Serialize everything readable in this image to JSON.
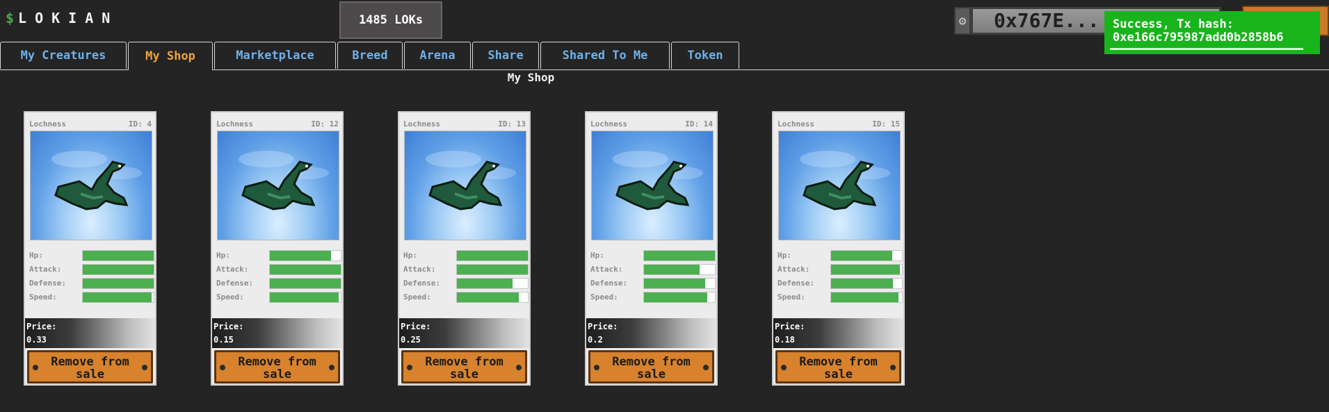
{
  "app": {
    "logo_text": "LOKIAN",
    "logo_symbol": "$"
  },
  "header": {
    "balance": "1485 LOKs",
    "wallet_address": "0x767E...",
    "toast": "Success, Tx hash:\n0xe166c795987add0b2858b6"
  },
  "tabs": [
    {
      "label": "My Creatures",
      "active": false
    },
    {
      "label": "My Shop",
      "active": true
    },
    {
      "label": "Marketplace",
      "active": false
    },
    {
      "label": "Breed",
      "active": false
    },
    {
      "label": "Arena",
      "active": false
    },
    {
      "label": "Share",
      "active": false
    },
    {
      "label": "Shared To Me",
      "active": false
    },
    {
      "label": "Token",
      "active": false
    }
  ],
  "section_title": "My Shop",
  "stat_labels": {
    "hp": "Hp:",
    "attack": "Attack:",
    "defense": "Defense:",
    "speed": "Speed:"
  },
  "price_label": "Price:",
  "remove_label": "Remove from sale",
  "colors": {
    "accent_tab": "#f2a33a",
    "tab_text": "#6fb1ea",
    "stat_fill": "#4caf50",
    "toast_bg": "#19b41c",
    "button": "#d8822e"
  },
  "cards": [
    {
      "name": "Lochness",
      "id": "ID: 4",
      "price": "0.33",
      "stats": {
        "hp": 1.0,
        "attack": 1.0,
        "defense": 1.0,
        "speed": 0.97
      }
    },
    {
      "name": "Lochness",
      "id": "ID: 12",
      "price": "0.15",
      "stats": {
        "hp": 0.86,
        "attack": 1.0,
        "defense": 1.0,
        "speed": 0.97
      }
    },
    {
      "name": "Lochness",
      "id": "ID: 13",
      "price": "0.25",
      "stats": {
        "hp": 1.0,
        "attack": 1.0,
        "defense": 0.78,
        "speed": 0.87
      }
    },
    {
      "name": "Lochness",
      "id": "ID: 14",
      "price": "0.2",
      "stats": {
        "hp": 1.0,
        "attack": 0.78,
        "defense": 0.86,
        "speed": 0.89
      }
    },
    {
      "name": "Lochness",
      "id": "ID: 15",
      "price": "0.18",
      "stats": {
        "hp": 0.86,
        "attack": 0.97,
        "defense": 0.87,
        "speed": 0.95
      }
    }
  ]
}
